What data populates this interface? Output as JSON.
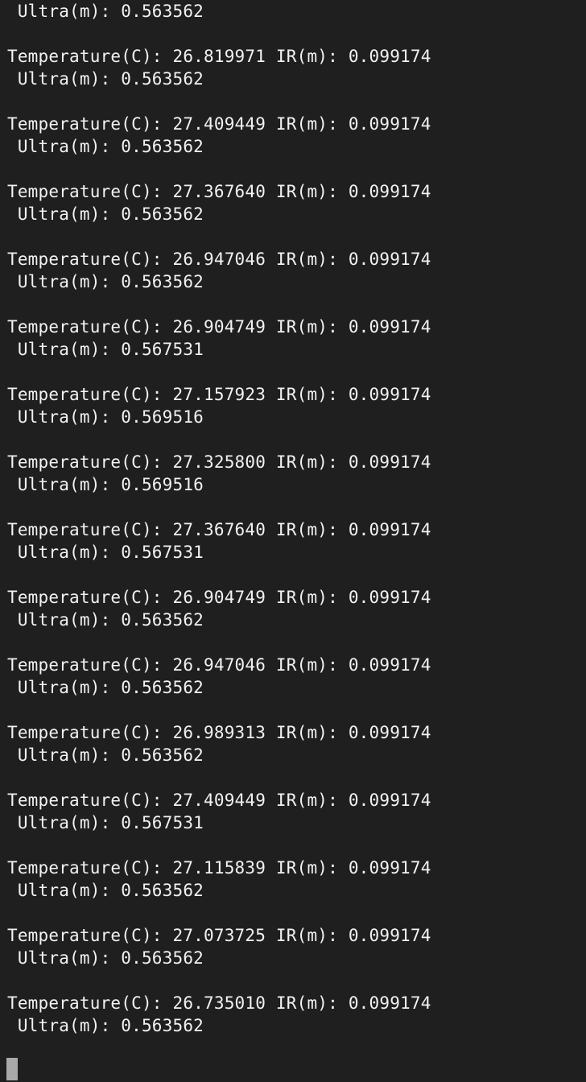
{
  "terminal": {
    "lines": [
      " Ultra(m): 0.563562",
      "",
      "Temperature(C): 26.819971 IR(m): 0.099174",
      " Ultra(m): 0.563562",
      "",
      "Temperature(C): 27.409449 IR(m): 0.099174",
      " Ultra(m): 0.563562",
      "",
      "Temperature(C): 27.367640 IR(m): 0.099174",
      " Ultra(m): 0.563562",
      "",
      "Temperature(C): 26.947046 IR(m): 0.099174",
      " Ultra(m): 0.563562",
      "",
      "Temperature(C): 26.904749 IR(m): 0.099174",
      " Ultra(m): 0.567531",
      "",
      "Temperature(C): 27.157923 IR(m): 0.099174",
      " Ultra(m): 0.569516",
      "",
      "Temperature(C): 27.325800 IR(m): 0.099174",
      " Ultra(m): 0.569516",
      "",
      "Temperature(C): 27.367640 IR(m): 0.099174",
      " Ultra(m): 0.567531",
      "",
      "Temperature(C): 26.904749 IR(m): 0.099174",
      " Ultra(m): 0.563562",
      "",
      "Temperature(C): 26.947046 IR(m): 0.099174",
      " Ultra(m): 0.563562",
      "",
      "Temperature(C): 26.989313 IR(m): 0.099174",
      " Ultra(m): 0.563562",
      "",
      "Temperature(C): 27.409449 IR(m): 0.099174",
      " Ultra(m): 0.567531",
      "",
      "Temperature(C): 27.115839 IR(m): 0.099174",
      " Ultra(m): 0.563562",
      "",
      "Temperature(C): 27.073725 IR(m): 0.099174",
      " Ultra(m): 0.563562",
      "",
      "Temperature(C): 26.735010 IR(m): 0.099174",
      " Ultra(m): 0.563562",
      "",
      ""
    ]
  },
  "colors": {
    "background": "#1f1f1f",
    "text": "#f2f2f2",
    "cursor": "#a9a9a9"
  }
}
